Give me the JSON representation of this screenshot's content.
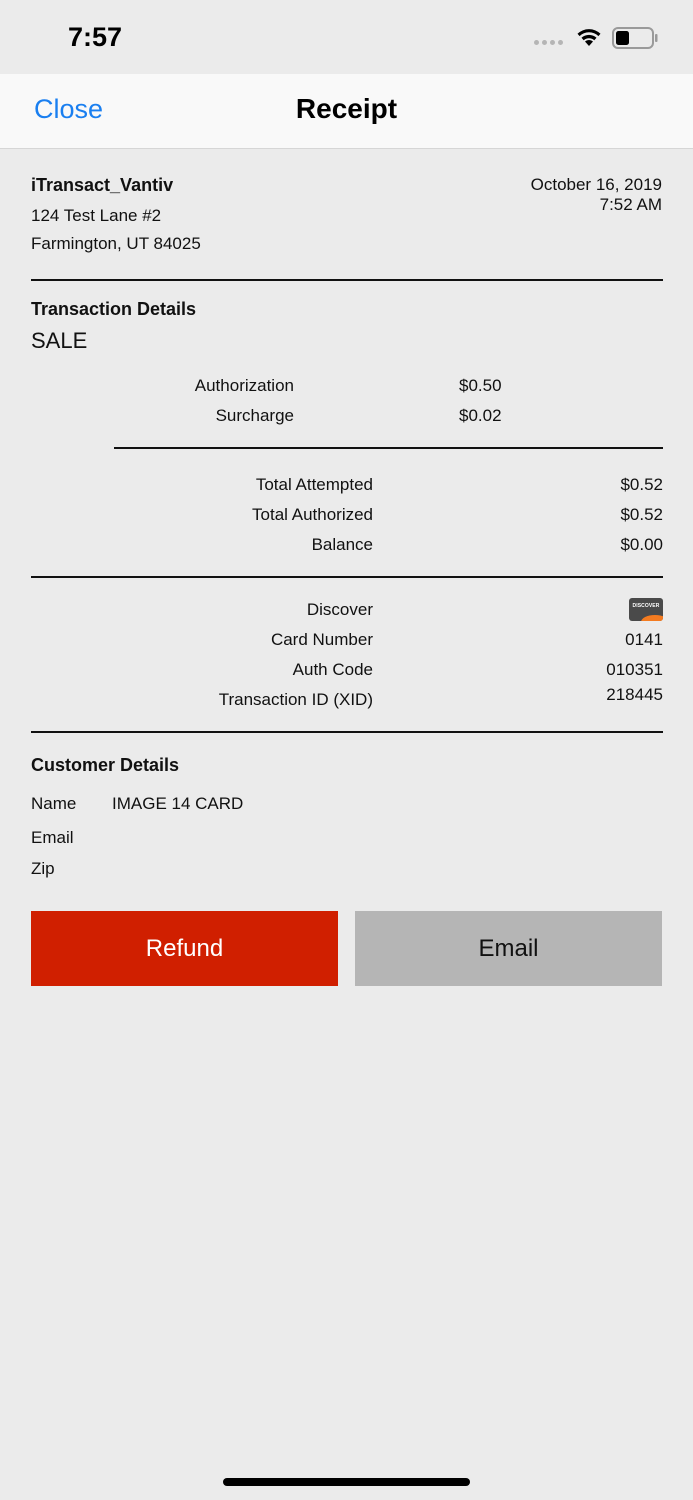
{
  "status_bar": {
    "time": "7:57"
  },
  "nav": {
    "close_label": "Close",
    "title": "Receipt"
  },
  "merchant": {
    "name": "iTransact_Vantiv",
    "address_line1": "124 Test Lane #2",
    "address_line2": "Farmington, UT 84025",
    "date": "October 16, 2019",
    "time": "7:52 AM"
  },
  "transaction": {
    "heading": "Transaction Details",
    "type": "SALE",
    "line_items": [
      {
        "label": "Authorization",
        "value": "$0.50"
      },
      {
        "label": "Surcharge",
        "value": "$0.02"
      }
    ],
    "totals": [
      {
        "label": "Total Attempted",
        "value": "$0.52"
      },
      {
        "label": "Total Authorized",
        "value": "$0.52"
      },
      {
        "label": "Balance",
        "value": "$0.00"
      }
    ],
    "card": {
      "brand": "Discover",
      "brand_icon": "discover-card-icon",
      "logo_text": "DISCOVER",
      "card_number_label": "Card Number",
      "card_number": "0141",
      "auth_code_label": "Auth Code",
      "auth_code": "010351",
      "xid_label": "Transaction ID (XID)",
      "xid": "218445"
    }
  },
  "customer": {
    "heading": "Customer Details",
    "name_label": "Name",
    "name": "IMAGE 14 CARD",
    "email_label": "Email",
    "zip_label": "Zip"
  },
  "actions": {
    "refund_label": "Refund",
    "email_label": "Email"
  },
  "colors": {
    "accent": "#1a7ff0",
    "refund": "#d01f00",
    "email_button": "#b5b5b5",
    "background": "#ebebeb"
  }
}
